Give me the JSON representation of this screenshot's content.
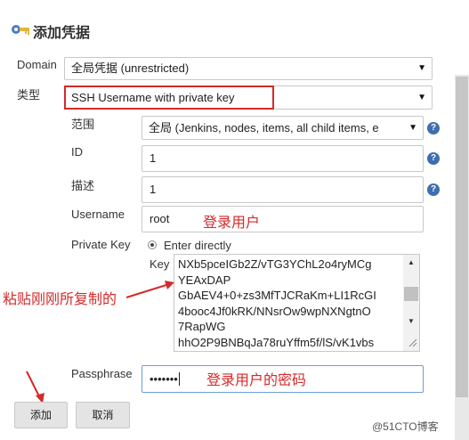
{
  "header": {
    "title": "添加凭据",
    "icon": "credentials-key-icon"
  },
  "form": {
    "domain": {
      "label": "Domain",
      "value": "全局凭据 (unrestricted)"
    },
    "kind": {
      "label": "类型",
      "value": "SSH Username with private key"
    },
    "scope": {
      "label": "范围",
      "value": "全局 (Jenkins, nodes, items, all child items, e"
    },
    "id": {
      "label": "ID",
      "value": "1"
    },
    "description": {
      "label": "描述",
      "value": "1"
    },
    "username": {
      "label": "Username",
      "value": "root"
    },
    "private_key": {
      "label": "Private Key",
      "option_label": "Enter directly",
      "key_label": "Key",
      "lines": [
        "NXb5pceIGb2Z/vTG3YChL2o4ryMCg",
        "YEAxDAP",
        "GbAEV4+0+zs3MfTJCRaKm+LI1RcGI",
        "4booc4Jf0kRK/NNsrOw9wpNXNgtnO",
        "7RapWG",
        "hhO2P9BNBqJa78ruYffm5f/lS/vK1vbs"
      ]
    },
    "passphrase": {
      "label": "Passphrase",
      "value": "•••••••"
    }
  },
  "annotations": {
    "login_user": "登录用户",
    "paste_copied": "粘贴刚刚所复制的",
    "login_password": "登录用户的密码"
  },
  "buttons": {
    "add": "添加",
    "cancel": "取消"
  },
  "watermark": "@51CTO博客",
  "colors": {
    "annotation_red": "#d42a2a",
    "help_blue": "#3d6fb0"
  }
}
